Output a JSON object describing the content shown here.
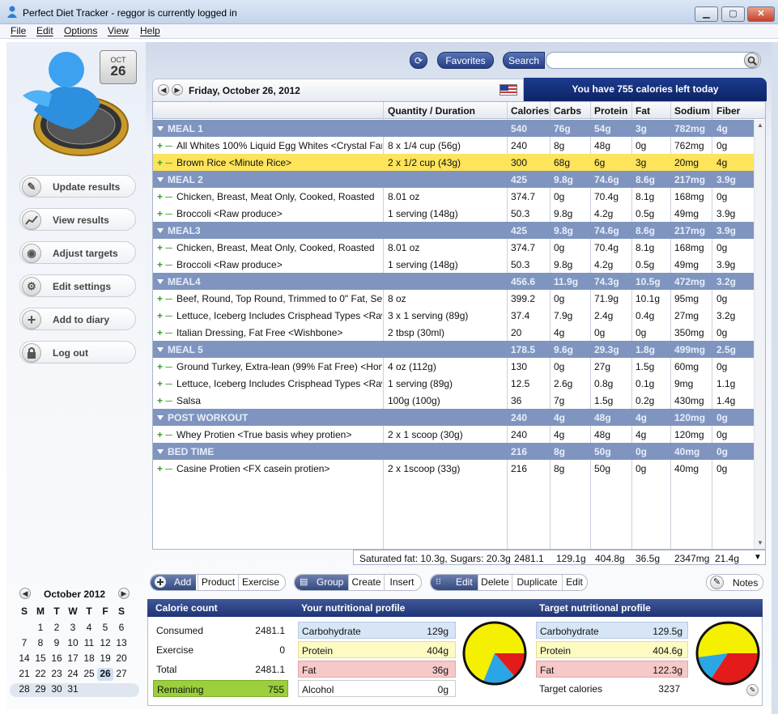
{
  "window": {
    "title": "Perfect Diet Tracker - reggor is currently logged in",
    "min": "▁",
    "max": "▢",
    "close": "✕"
  },
  "menu": [
    "File",
    "Edit",
    "Options",
    "View",
    "Help"
  ],
  "calendar_icon": {
    "month": "OCT",
    "day": "26"
  },
  "nav": [
    {
      "label": "Update results",
      "icon": "pencil-icon",
      "glyph": "✎"
    },
    {
      "label": "View results",
      "icon": "chart-icon",
      "glyph": "📈"
    },
    {
      "label": "Adjust targets",
      "icon": "target-icon",
      "glyph": "◉"
    },
    {
      "label": "Edit settings",
      "icon": "gear-icon",
      "glyph": "⚙"
    },
    {
      "label": "Add to diary",
      "icon": "plus-icon",
      "glyph": "+"
    },
    {
      "label": "Log out",
      "icon": "lock-icon",
      "glyph": "🔒"
    }
  ],
  "minical": {
    "month": "October 2012",
    "prev": "◀",
    "next": "▶",
    "dow": [
      "S",
      "M",
      "T",
      "W",
      "T",
      "F",
      "S"
    ],
    "weeks": [
      [
        "",
        "",
        "1",
        "2",
        "3",
        "4",
        "5",
        "6"
      ],
      [
        "7",
        "8",
        "9",
        "10",
        "11",
        "12",
        "13"
      ],
      [
        "14",
        "15",
        "16",
        "17",
        "18",
        "19",
        "20"
      ],
      [
        "21",
        "22",
        "23",
        "24",
        "25",
        "26",
        "27"
      ],
      [
        "28",
        "29",
        "30",
        "31",
        "",
        "",
        ""
      ]
    ],
    "selected": "26"
  },
  "toolbar": {
    "favorites": "Favorites",
    "search": "Search",
    "search_value": "",
    "refresh": "⟳"
  },
  "date": {
    "label": "Friday, October 26, 2012",
    "prev": "◀",
    "next": "▶"
  },
  "calories_left": "You have 755 calories left today",
  "columns": [
    "Quantity / Duration",
    "Calories",
    "Carbs",
    "Protein",
    "Fat",
    "Sodium",
    "Fiber"
  ],
  "rows": [
    {
      "type": "meal",
      "name": "MEAL 1",
      "qty": "",
      "cal": "540",
      "carbs": "76g",
      "protein": "54g",
      "fat": "3g",
      "sodium": "782mg",
      "fiber": "4g"
    },
    {
      "type": "food",
      "name": "All Whites 100% Liquid Egg Whites <Crystal Farms>",
      "qty": "8 x 1/4 cup (56g)",
      "cal": "240",
      "carbs": "8g",
      "protein": "48g",
      "fat": "0g",
      "sodium": "762mg",
      "fiber": "0g"
    },
    {
      "type": "food",
      "sel": true,
      "name": "Brown Rice <Minute Rice>",
      "qty": "2 x 1/2 cup (43g)",
      "cal": "300",
      "carbs": "68g",
      "protein": "6g",
      "fat": "3g",
      "sodium": "20mg",
      "fiber": "4g"
    },
    {
      "type": "meal",
      "name": "MEAL 2",
      "qty": "",
      "cal": "425",
      "carbs": "9.8g",
      "protein": "74.6g",
      "fat": "8.6g",
      "sodium": "217mg",
      "fiber": "3.9g"
    },
    {
      "type": "food",
      "name": "Chicken, Breast, Meat Only, Cooked, Roasted",
      "qty": "8.01 oz",
      "cal": "374.7",
      "carbs": "0g",
      "protein": "70.4g",
      "fat": "8.1g",
      "sodium": "168mg",
      "fiber": "0g"
    },
    {
      "type": "food",
      "name": "Broccoli <Raw produce>",
      "qty": "1 serving (148g)",
      "cal": "50.3",
      "carbs": "9.8g",
      "protein": "4.2g",
      "fat": "0.5g",
      "sodium": "49mg",
      "fiber": "3.9g"
    },
    {
      "type": "meal",
      "name": "MEAL3",
      "qty": "",
      "cal": "425",
      "carbs": "9.8g",
      "protein": "74.6g",
      "fat": "8.6g",
      "sodium": "217mg",
      "fiber": "3.9g"
    },
    {
      "type": "food",
      "name": "Chicken, Breast, Meat Only, Cooked, Roasted",
      "qty": "8.01 oz",
      "cal": "374.7",
      "carbs": "0g",
      "protein": "70.4g",
      "fat": "8.1g",
      "sodium": "168mg",
      "fiber": "0g"
    },
    {
      "type": "food",
      "name": "Broccoli <Raw produce>",
      "qty": "1 serving (148g)",
      "cal": "50.3",
      "carbs": "9.8g",
      "protein": "4.2g",
      "fat": "0.5g",
      "sodium": "49mg",
      "fiber": "3.9g"
    },
    {
      "type": "meal",
      "name": "MEAL4",
      "qty": "",
      "cal": "456.6",
      "carbs": "11.9g",
      "protein": "74.3g",
      "fat": "10.5g",
      "sodium": "472mg",
      "fiber": "3.2g"
    },
    {
      "type": "food",
      "name": "Beef, Round, Top Round, Trimmed to 0\" Fat, Select",
      "qty": "8 oz",
      "cal": "399.2",
      "carbs": "0g",
      "protein": "71.9g",
      "fat": "10.1g",
      "sodium": "95mg",
      "fiber": "0g"
    },
    {
      "type": "food",
      "name": "Lettuce, Iceberg Includes Crisphead Types <Raw produce>",
      "qty": "3 x 1 serving (89g)",
      "cal": "37.4",
      "carbs": "7.9g",
      "protein": "2.4g",
      "fat": "0.4g",
      "sodium": "27mg",
      "fiber": "3.2g"
    },
    {
      "type": "food",
      "name": "Italian Dressing, Fat Free <Wishbone>",
      "qty": "2 tbsp (30ml)",
      "cal": "20",
      "carbs": "4g",
      "protein": "0g",
      "fat": "0g",
      "sodium": "350mg",
      "fiber": "0g"
    },
    {
      "type": "meal",
      "name": "MEAL 5",
      "qty": "",
      "cal": "178.5",
      "carbs": "9.6g",
      "protein": "29.3g",
      "fat": "1.8g",
      "sodium": "499mg",
      "fiber": "2.5g"
    },
    {
      "type": "food",
      "name": "Ground Turkey, Extra-lean (99% Fat Free) <Honeysuckle>",
      "qty": "4 oz (112g)",
      "cal": "130",
      "carbs": "0g",
      "protein": "27g",
      "fat": "1.5g",
      "sodium": "60mg",
      "fiber": "0g"
    },
    {
      "type": "food",
      "name": "Lettuce, Iceberg Includes Crisphead Types <Raw produce>",
      "qty": "1 serving (89g)",
      "cal": "12.5",
      "carbs": "2.6g",
      "protein": "0.8g",
      "fat": "0.1g",
      "sodium": "9mg",
      "fiber": "1.1g"
    },
    {
      "type": "food",
      "name": "Salsa",
      "qty": "100g (100g)",
      "cal": "36",
      "carbs": "7g",
      "protein": "1.5g",
      "fat": "0.2g",
      "sodium": "430mg",
      "fiber": "1.4g"
    },
    {
      "type": "meal",
      "name": "POST WORKOUT",
      "qty": "",
      "cal": "240",
      "carbs": "4g",
      "protein": "48g",
      "fat": "4g",
      "sodium": "120mg",
      "fiber": "0g"
    },
    {
      "type": "food",
      "name": "Whey Protien <True basis whey protien>",
      "qty": "2 x 1 scoop (30g)",
      "cal": "240",
      "carbs": "4g",
      "protein": "48g",
      "fat": "4g",
      "sodium": "120mg",
      "fiber": "0g"
    },
    {
      "type": "meal",
      "name": "BED TIME",
      "qty": "",
      "cal": "216",
      "carbs": "8g",
      "protein": "50g",
      "fat": "0g",
      "sodium": "40mg",
      "fiber": "0g"
    },
    {
      "type": "food",
      "name": "Casine Protien <FX casein protien>",
      "qty": "2 x 1scoop (33g)",
      "cal": "216",
      "carbs": "8g",
      "protein": "50g",
      "fat": "0g",
      "sodium": "40mg",
      "fiber": "0g"
    }
  ],
  "totals": {
    "note": "Saturated fat: 10.3g, Sugars: 20.3g",
    "cal": "2481.1",
    "carbs": "129.1g",
    "protein": "404.8g",
    "fat": "36.5g",
    "sodium": "2347mg",
    "fiber": "21.4g"
  },
  "actions": {
    "add": "Add",
    "product": "Product",
    "exercise": "Exercise",
    "group": "Group",
    "create": "Create",
    "insert": "Insert",
    "edit": "Edit",
    "delete": "Delete",
    "duplicate": "Duplicate",
    "edit2": "Edit",
    "notes": "Notes"
  },
  "calorie_count": {
    "title": "Calorie count",
    "consumed_label": "Consumed",
    "consumed": "2481.1",
    "exercise_label": "Exercise",
    "exercise": "0",
    "total_label": "Total",
    "total": "2481.1",
    "remaining_label": "Remaining",
    "remaining": "755"
  },
  "profile": {
    "title": "Your nutritional profile",
    "carb_label": "Carbohydrate",
    "carb": "129g",
    "protein_label": "Protein",
    "protein": "404g",
    "fat_label": "Fat",
    "fat": "36g",
    "alcohol_label": "Alcohol",
    "alcohol": "0g"
  },
  "target": {
    "title": "Target nutritional profile",
    "carb_label": "Carbohydrate",
    "carb": "129.5g",
    "protein_label": "Protein",
    "protein": "404.6g",
    "fat_label": "Fat",
    "fat": "122.3g",
    "cal_label": "Target calories",
    "cal": "3237"
  },
  "colors": {
    "carb": "#2aa6e6",
    "protein": "#f5f000",
    "fat": "#e31b1b",
    "carb_bg": "#d6e6f7",
    "protein_bg": "#fdfac2",
    "fat_bg": "#f6c8c8",
    "remaining_bg": "#9bcf3c"
  }
}
